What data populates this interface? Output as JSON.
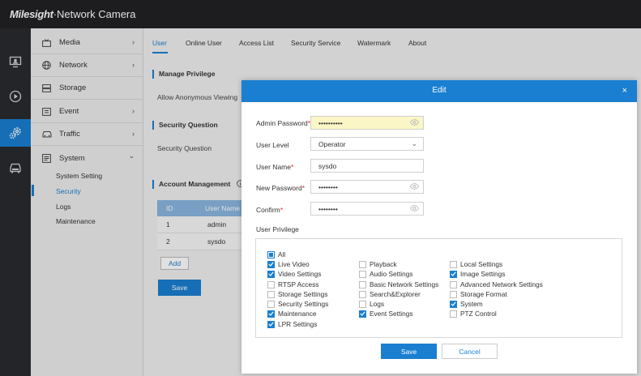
{
  "app": {
    "brand": "Milesight",
    "title": "·Network Camera"
  },
  "colors": {
    "accent": "#1a7fd0",
    "topbar": "#212224",
    "highlight_input": "#fbf6c6",
    "required": "#e22222"
  },
  "iconbar": [
    {
      "icon": "monitor-icon"
    },
    {
      "icon": "playback-icon"
    },
    {
      "icon": "settings-icon",
      "active": true
    },
    {
      "icon": "vehicle-icon"
    }
  ],
  "sidebar": {
    "items": [
      {
        "label": "Media",
        "icon": "media-icon",
        "arrow": "›"
      },
      {
        "label": "Network",
        "icon": "globe-icon",
        "arrow": "›"
      },
      {
        "label": "Storage",
        "icon": "storage-icon",
        "arrow": ""
      },
      {
        "label": "Event",
        "icon": "event-icon",
        "arrow": "›"
      },
      {
        "label": "Traffic",
        "icon": "car-icon",
        "arrow": "›"
      },
      {
        "label": "System",
        "icon": "system-icon",
        "arrow": "⌄"
      }
    ],
    "subitems": [
      "System Setting",
      "Security",
      "Logs",
      "Maintenance"
    ],
    "active_subitem": "Security"
  },
  "tabs": [
    "User",
    "Online User",
    "Access List",
    "Security Service",
    "Watermark",
    "About"
  ],
  "background": {
    "manage_privilege": "Manage Privilege",
    "allow_anonymous": "Allow Anonymous Viewing",
    "security_question_title": "Security Question",
    "security_question_label": "Security Question",
    "account_management": "Account Management",
    "info_icon": "info-icon",
    "table": {
      "headers": [
        "ID",
        "User Name"
      ],
      "rows": [
        [
          "1",
          "admin"
        ],
        [
          "2",
          "sysdo"
        ]
      ]
    },
    "add": "Add",
    "save": "Save"
  },
  "modal": {
    "title": "Edit",
    "close": "×",
    "fields": {
      "admin_password": {
        "label": "Admin Password",
        "value": "••••••••••"
      },
      "user_level": {
        "label": "User Level",
        "value": "Operator"
      },
      "user_name": {
        "label": "User Name",
        "value": "sysdo"
      },
      "new_password": {
        "label": "New Password",
        "value": "••••••••"
      },
      "confirm": {
        "label": "Confirm",
        "value": "••••••••"
      }
    },
    "required_mark": "*",
    "privilege_label": "User Privilege",
    "all": {
      "label": "All",
      "state": "partial"
    },
    "privileges": [
      {
        "label": "Live Video",
        "checked": true
      },
      {
        "label": "Playback",
        "checked": false
      },
      {
        "label": "Local Settings",
        "checked": false
      },
      {
        "label": "Video Settings",
        "checked": true
      },
      {
        "label": "Audio Settings",
        "checked": false
      },
      {
        "label": "Image Settings",
        "checked": true
      },
      {
        "label": "RTSP Access",
        "checked": false
      },
      {
        "label": "Basic Network Settings",
        "checked": false
      },
      {
        "label": "Advanced Network Settings",
        "checked": false
      },
      {
        "label": "Storage Settings",
        "checked": false
      },
      {
        "label": "Search&Explorer",
        "checked": false
      },
      {
        "label": "Storage Format",
        "checked": false
      },
      {
        "label": "Security Settings",
        "checked": false
      },
      {
        "label": "Logs",
        "checked": false
      },
      {
        "label": "System",
        "checked": true
      },
      {
        "label": "Maintenance",
        "checked": true
      },
      {
        "label": "Event Settings",
        "checked": true
      },
      {
        "label": "PTZ Control",
        "checked": false
      },
      {
        "label": "LPR Settings",
        "checked": true
      }
    ],
    "save": "Save",
    "cancel": "Cancel"
  }
}
